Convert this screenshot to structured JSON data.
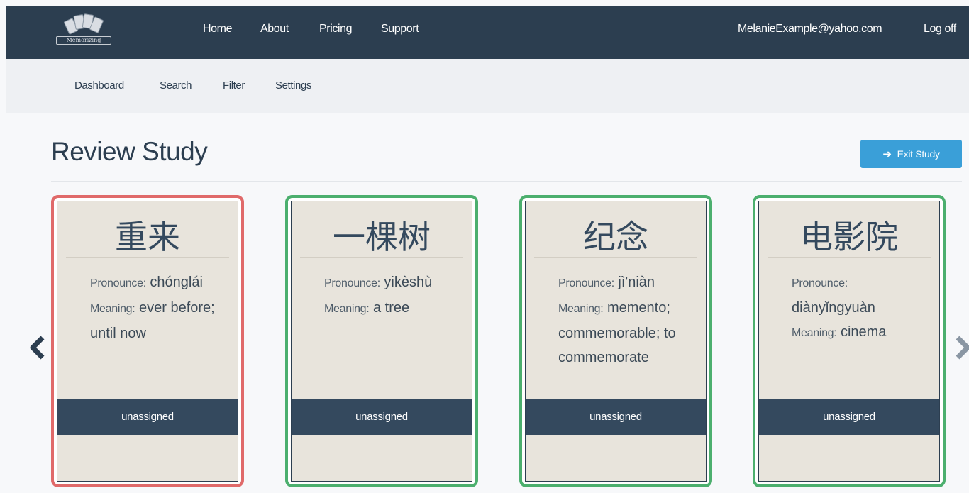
{
  "topbar": {
    "logo_text": "Memorizing",
    "nav": [
      "Home",
      "About",
      "Pricing",
      "Support"
    ],
    "user_email": "MelanieExample@yahoo.com",
    "logoff": "Log off"
  },
  "subnav": [
    "Dashboard",
    "Search",
    "Filter",
    "Settings"
  ],
  "page": {
    "title": "Review Study",
    "exit_label": "Exit Study"
  },
  "labels": {
    "pronounce": "Pronounce:",
    "meaning": "Meaning:"
  },
  "cards": [
    {
      "hanzi": "重来",
      "pronounce": "chónglái",
      "meaning": "ever before; until now",
      "status": "unassigned",
      "state": "wrong"
    },
    {
      "hanzi": "一棵树",
      "pronounce": "yikèshù",
      "meaning": "a tree",
      "status": "unassigned",
      "state": "correct"
    },
    {
      "hanzi": "纪念",
      "pronounce": "jì'niàn",
      "meaning": "memento; commemorable; to commemorate",
      "status": "unassigned",
      "state": "correct"
    },
    {
      "hanzi": "电影院",
      "pronounce": "diànyǐngyuàn",
      "meaning": "cinema",
      "status": "unassigned",
      "state": "correct"
    }
  ],
  "colors": {
    "navbar": "#2c3e50",
    "accent": "#3a9fd8",
    "correct": "#4caf6e",
    "wrong": "#e06a6a"
  },
  "icons": {
    "exit": "arrow-right-icon",
    "prev": "chevron-left-icon",
    "next": "chevron-right-icon"
  }
}
